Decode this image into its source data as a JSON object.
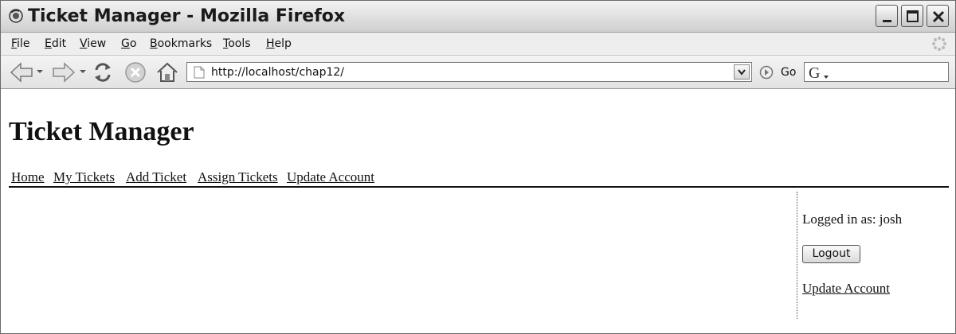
{
  "window": {
    "title": "Ticket Manager - Mozilla Firefox"
  },
  "menubar": {
    "items": [
      {
        "key": "F",
        "rest": "ile"
      },
      {
        "key": "E",
        "rest": "dit"
      },
      {
        "key": "V",
        "rest": "iew"
      },
      {
        "key": "G",
        "rest": "o"
      },
      {
        "key": "B",
        "rest": "ookmarks"
      },
      {
        "key": "T",
        "rest": "ools"
      },
      {
        "key": "H",
        "rest": "elp"
      }
    ]
  },
  "toolbar": {
    "url": "http://localhost/chap12/",
    "go_label": "Go",
    "icons": [
      "back-icon",
      "forward-icon",
      "reload-icon",
      "stop-icon",
      "home-icon",
      "page-icon",
      "go-icon",
      "google-search-icon"
    ]
  },
  "page": {
    "title": "Ticket Manager",
    "nav": [
      "Home",
      "My Tickets",
      "Add Ticket",
      "Assign Tickets",
      "Update Account"
    ],
    "sidebar": {
      "logged_in": "Logged in as: josh",
      "logout_label": "Logout",
      "update_account": "Update Account"
    }
  }
}
